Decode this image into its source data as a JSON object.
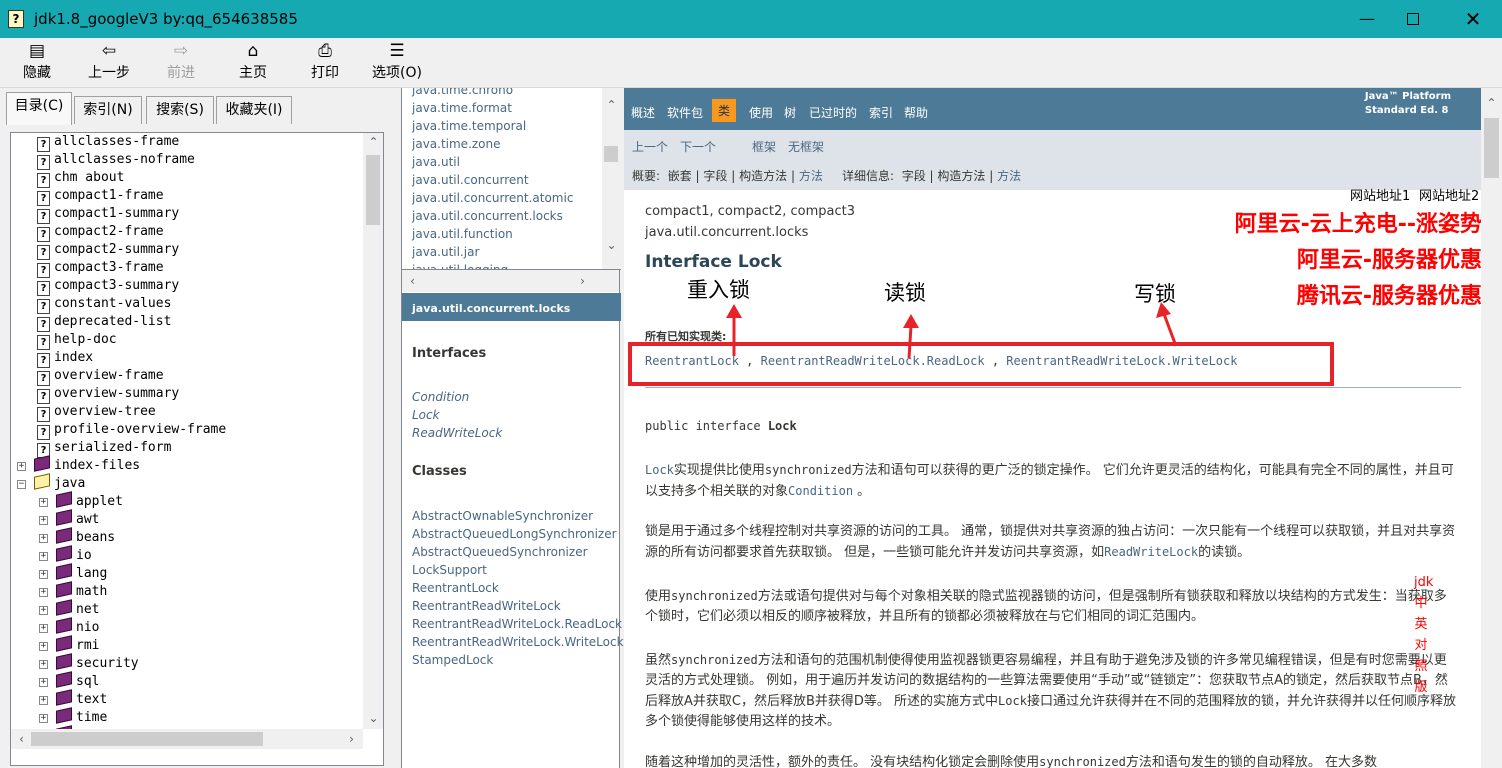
{
  "window": {
    "title": "jdk1.8_googleV3 by:qq_654638585"
  },
  "toolbar": {
    "hide": "隐藏",
    "back": "上一步",
    "forward": "前进",
    "home": "主页",
    "print": "打印",
    "options": "选项(O)"
  },
  "tabs": [
    "目录(C)",
    "索引(N)",
    "搜索(S)",
    "收藏夹(I)"
  ],
  "tree": {
    "pages": [
      "allclasses-frame",
      "allclasses-noframe",
      "chm about",
      "compact1-frame",
      "compact1-summary",
      "compact2-frame",
      "compact2-summary",
      "compact3-frame",
      "compact3-summary",
      "constant-values",
      "deprecated-list",
      "help-doc",
      "index",
      "overview-frame",
      "overview-summary",
      "overview-tree",
      "profile-overview-frame",
      "serialized-form"
    ],
    "index_files": "index-files",
    "java": "java",
    "java_children": [
      "applet",
      "awt",
      "beans",
      "io",
      "lang",
      "math",
      "net",
      "nio",
      "rmi",
      "security",
      "sql",
      "text",
      "time",
      "util"
    ]
  },
  "packages": [
    "java.time.chrono",
    "java.time.format",
    "java.time.temporal",
    "java.time.zone",
    "java.util",
    "java.util.concurrent",
    "java.util.concurrent.atomic",
    "java.util.concurrent.locks",
    "java.util.function",
    "java.util.jar",
    "java.util.logging"
  ],
  "package_frame": {
    "header": "java.util.concurrent.locks",
    "interfaces_title": "Interfaces",
    "interfaces": [
      "Condition",
      "Lock",
      "ReadWriteLock"
    ],
    "classes_title": "Classes",
    "classes": [
      "AbstractOwnableSynchronizer",
      "AbstractQueuedLongSynchronizer",
      "AbstractQueuedSynchronizer",
      "LockSupport",
      "ReentrantLock",
      "ReentrantReadWriteLock",
      "ReentrantReadWriteLock.ReadLock",
      "ReentrantReadWriteLock.WriteLock",
      "StampedLock"
    ]
  },
  "topnav": {
    "items": [
      "概述",
      "软件包",
      "类",
      "使用",
      "树",
      "已过时的",
      "索引",
      "帮助"
    ],
    "selected": "类",
    "platform_line1": "Java™ Platform",
    "platform_line2": "Standard Ed. 8"
  },
  "subnav": {
    "prev": "上一个",
    "next": "下一个",
    "frames": "框架",
    "noframes": "无框架",
    "summary_label": "概要:",
    "summary_nested": "嵌套",
    "summary_field": "字段",
    "summary_ctor": "构造方法",
    "summary_method": "方法",
    "detail_label": "详细信息:",
    "detail_field": "字段",
    "detail_ctor": "构造方法",
    "detail_method": "方法",
    "sep": "|"
  },
  "site_links": [
    "网站地址1",
    "网站地址2"
  ],
  "promos": [
    "阿里云-云上充电--涨姿势",
    "阿里云-服务器优惠",
    "腾讯云-服务器优惠"
  ],
  "content": {
    "profiles": "compact1, compact2, compact3",
    "package": "java.util.concurrent.locks",
    "title": "Interface Lock",
    "annotations": [
      "重入锁",
      "读锁",
      "写锁"
    ],
    "all_impl_title": "所有已知实现类:",
    "impl_classes": [
      "ReentrantLock",
      "ReentrantReadWriteLock.ReadLock",
      "ReentrantReadWriteLock.WriteLock"
    ],
    "comma": ",",
    "signature_prefix": "public interface ",
    "signature_name": "Lock",
    "p1_a": "Lock",
    "p1_b": "实现提供比使用",
    "p1_c": "synchronized",
    "p1_d": "方法和语句可以获得的更广泛的锁定操作。 它们允许更灵活的结构化，可能具有完全不同的属性，并且可以支持多个相关联的对象",
    "p1_e": "Condition",
    "p1_f": " 。",
    "p2_a": "锁是用于通过多个线程控制对共享资源的访问的工具。 通常，锁提供对共享资源的独占访问：一次只能有一个线程可以获取锁，并且对共享资源的所有访问都要求首先获取锁。 但是，一些锁可能允许并发访问共享资源，如",
    "p2_b": "ReadWriteLock",
    "p2_c": "的读锁。",
    "p3_a": "使用",
    "p3_b": "synchronized",
    "p3_c": "方法或语句提供对与每个对象相关联的隐式监视器锁的访问，但是强制所有锁获取和释放以块结构的方式发生：当获取多个锁时，它们必须以相反的顺序被释放，并且所有的锁都必须被释放在与它们相同的词汇范围内。",
    "p4_a": "虽然",
    "p4_b": "synchronized",
    "p4_c": "方法和语句的范围机制使得使用监视器锁更容易编程，并且有助于避免涉及锁的许多常见编程错误，但是有时您需要以更灵活的方式处理锁。 例如，用于遍历并发访问的数据结构的一些算法需要使用“手动”或“链锁定”：您获取节点A的锁定，然后获取节点B，然后释放A并获取C，然后释放B并获得D等。 所述的实施方式中",
    "p4_d": "Lock",
    "p4_e": "接口通过允许获得并在不同的范围释放的锁，并允许获得并以任何顺序释放多个锁使得能够使用这样的技术。",
    "p5_a": "随着这种增加的灵活性，额外的责任。 没有块结构化锁定会删除使用",
    "p5_b": "synchronized",
    "p5_c": "方法和语句发生的锁的自动释放。 在大多数",
    "vertical_text": [
      "jdk",
      "中",
      "英",
      "对",
      "照",
      "版"
    ]
  },
  "colors": {
    "titlebar": "#17a9b2",
    "nav": "#4d7a97",
    "selected_tab": "#f8981d",
    "subnav": "#dee3e9",
    "link": "#4a6782",
    "annotation_red": "#e7232a"
  }
}
